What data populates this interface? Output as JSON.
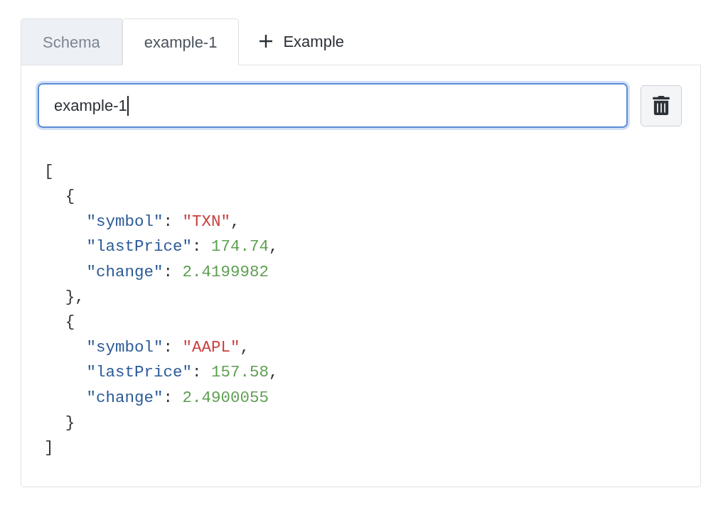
{
  "tabs": [
    {
      "label": "Schema",
      "selected": false
    },
    {
      "label": "example-1",
      "selected": true
    }
  ],
  "add_button": {
    "label": "Example"
  },
  "name_field": {
    "value": "example-1",
    "focused": true
  },
  "code": {
    "lines": [
      {
        "tokens": [
          {
            "kind": "punct",
            "text": "["
          }
        ],
        "children": [
          {
            "tokens": [
              {
                "kind": "punct",
                "text": "{"
              }
            ],
            "children": [
              {
                "tokens": [
                  {
                    "kind": "key",
                    "text": "\"symbol\""
                  },
                  {
                    "kind": "punct",
                    "text": ": "
                  },
                  {
                    "kind": "string",
                    "text": "\"TXN\""
                  },
                  {
                    "kind": "punct",
                    "text": ","
                  }
                ]
              },
              {
                "tokens": [
                  {
                    "kind": "key",
                    "text": "\"lastPrice\""
                  },
                  {
                    "kind": "punct",
                    "text": ": "
                  },
                  {
                    "kind": "number",
                    "text": "174.74"
                  },
                  {
                    "kind": "punct",
                    "text": ","
                  }
                ]
              },
              {
                "tokens": [
                  {
                    "kind": "key",
                    "text": "\"change\""
                  },
                  {
                    "kind": "punct",
                    "text": ": "
                  },
                  {
                    "kind": "number",
                    "text": "2.4199982"
                  }
                ]
              }
            ]
          },
          {
            "tokens": [
              {
                "kind": "punct",
                "text": "},"
              }
            ]
          },
          {
            "tokens": [
              {
                "kind": "punct",
                "text": "{"
              }
            ],
            "children": [
              {
                "tokens": [
                  {
                    "kind": "key",
                    "text": "\"symbol\""
                  },
                  {
                    "kind": "punct",
                    "text": ": "
                  },
                  {
                    "kind": "string",
                    "text": "\"AAPL\""
                  },
                  {
                    "kind": "punct",
                    "text": ","
                  }
                ]
              },
              {
                "tokens": [
                  {
                    "kind": "key",
                    "text": "\"lastPrice\""
                  },
                  {
                    "kind": "punct",
                    "text": ": "
                  },
                  {
                    "kind": "number",
                    "text": "157.58"
                  },
                  {
                    "kind": "punct",
                    "text": ","
                  }
                ]
              },
              {
                "tokens": [
                  {
                    "kind": "key",
                    "text": "\"change\""
                  },
                  {
                    "kind": "punct",
                    "text": ": "
                  },
                  {
                    "kind": "number",
                    "text": "2.4900055"
                  }
                ]
              }
            ]
          },
          {
            "tokens": [
              {
                "kind": "punct",
                "text": "}"
              }
            ]
          }
        ]
      },
      {
        "tokens": [
          {
            "kind": "punct",
            "text": "]"
          }
        ]
      }
    ]
  }
}
